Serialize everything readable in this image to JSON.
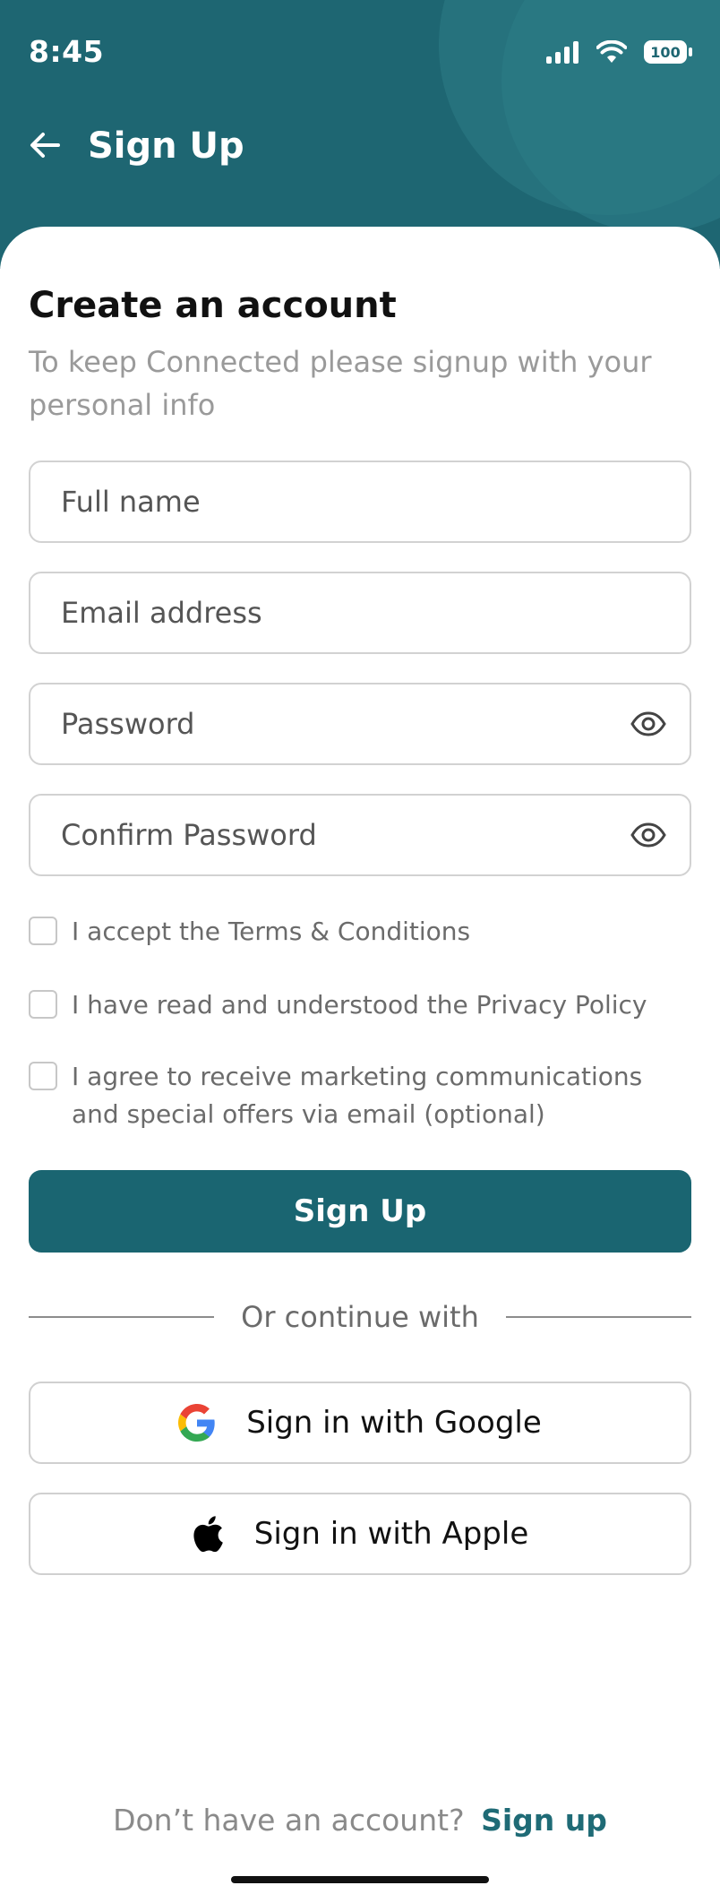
{
  "status_bar": {
    "time": "8:45",
    "battery": "100"
  },
  "header": {
    "title": "Sign Up",
    "back_icon": "arrow-left-icon"
  },
  "content": {
    "title": "Create an account",
    "subtitle": "To keep Connected please signup with your personal info"
  },
  "form": {
    "full_name_placeholder": "Full name",
    "email_placeholder": "Email address",
    "password_placeholder": "Password",
    "confirm_password_placeholder": "Confirm Password",
    "terms_label": "I accept the Terms & Conditions",
    "privacy_label": "I have read and understood the Privacy Policy",
    "marketing_label": " I agree to receive marketing communications and special offers via email (optional)",
    "submit_label": "Sign Up"
  },
  "social": {
    "divider_text": "Or continue with",
    "google_label": "Sign in with Google",
    "apple_label": "Sign in with Apple"
  },
  "footer": {
    "prompt": "Don’t have an account?",
    "link": "Sign up"
  },
  "colors": {
    "brand": "#1a6571",
    "header_bg": "#1e6672",
    "muted_text": "#9a9a9a"
  }
}
